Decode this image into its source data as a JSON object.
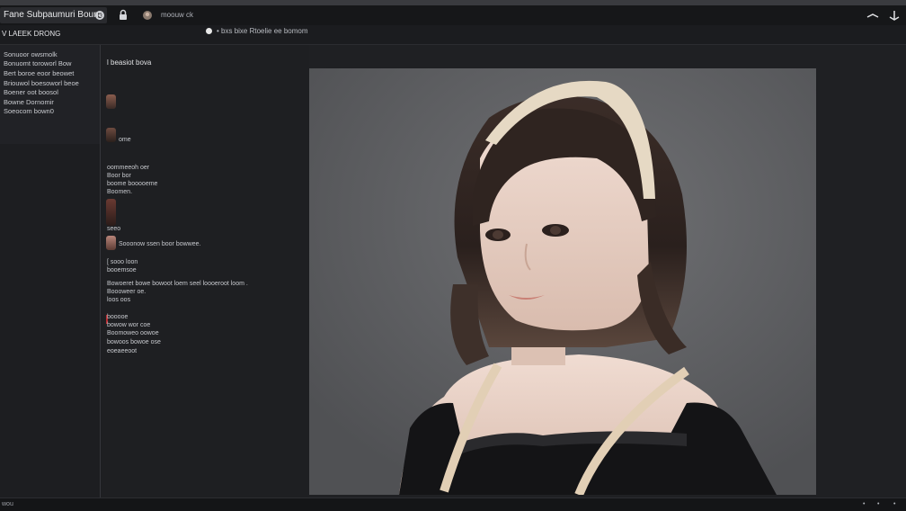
{
  "app": {
    "title": "Fane Subpaumuri Bouna"
  },
  "toolbar": {
    "icons": [
      "settings-icon",
      "lock-icon",
      "avatar-icon",
      "collapse-icon",
      "expand-icon"
    ],
    "menu_label": "moouw ck",
    "prompt_text": "• bxs bixe Rtoelie  ee bomom"
  },
  "sidebar": {
    "header": "V LAEEK DRONG",
    "items": [
      "Sonuoor owsmolk",
      "Bonuomt toroworl Bow",
      "Bert boroe eoor beowet",
      "Briouwol boesoworl beoe",
      "Boener oot  boosol",
      "Bowne  Dornomir",
      "Soeocom bown0"
    ]
  },
  "layers": {
    "heading": "l beasiot bova",
    "texts": [
      "ome",
      "oommeeoh oer",
      "Boor bor",
      "boome booooeme",
      "Boomen.",
      "seeo",
      "Sooonow ssen boor bowwee.",
      "[ sooo    loon",
      "booemsoe",
      "Bowoeret  bowe  bowoot loem seel loooeroot  loom .",
      "Boooweer  oe.",
      "loos oos",
      "booooe",
      "bowow wor coe",
      "Boomoweo  oowoe",
      "bowoos  bowoe ose",
      "eoeaeeoot"
    ]
  },
  "canvas": {
    "colors": {
      "backdrop": "#5f6063",
      "hair": "#2f2420",
      "skin": "#e9d2c6",
      "headband": "#e6d9c4",
      "dress": "#121214"
    }
  },
  "status": {
    "left": "wou",
    "right": [
      "•",
      "•",
      "•"
    ]
  }
}
